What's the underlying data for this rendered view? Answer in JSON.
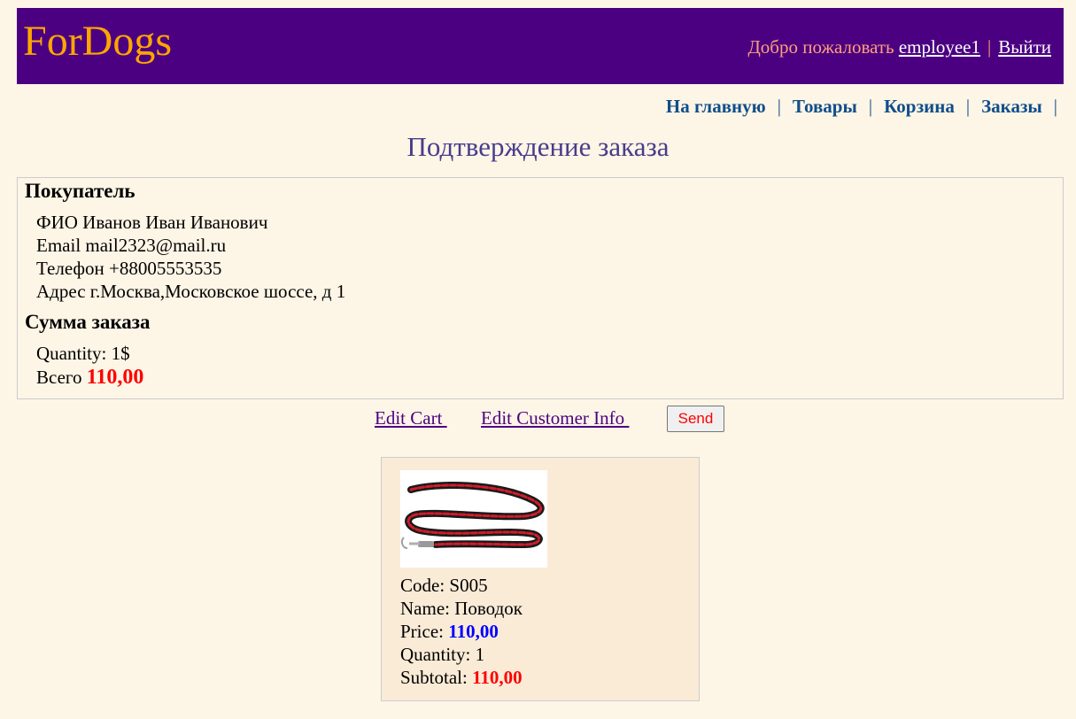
{
  "header": {
    "logo": "ForDogs",
    "welcome_text": "Добро пожаловать",
    "username": "employee1",
    "separator": "|",
    "logout_label": "Выйти"
  },
  "nav": {
    "items": [
      {
        "label": "На главную"
      },
      {
        "label": "Товары"
      },
      {
        "label": "Корзина"
      },
      {
        "label": "Заказы"
      }
    ],
    "separator": "|"
  },
  "page_title": "Подтверждение заказа",
  "customer": {
    "section_title": "Покупатель",
    "name_line": "ФИО Иванов Иван Иванович",
    "email_line": "Email mail2323@mail.ru",
    "phone_line": "Телефон +88005553535",
    "address_line": "Адрес г.Москва,Московское шоссе, д 1"
  },
  "summary": {
    "section_title": "Сумма заказа",
    "quantity_line": "Quantity: 1$",
    "total_label": "Всего",
    "total_value": "110,00"
  },
  "actions": {
    "edit_cart_label": "Edit Cart ",
    "edit_customer_label": "Edit Customer Info ",
    "send_label": "Send"
  },
  "product": {
    "image_icon": "dog-leash-image",
    "code_label": "Code:",
    "code": "S005",
    "name_label": "Name:",
    "name": "Поводок",
    "price_label": "Price:",
    "price": "110,00",
    "quantity_label": "Quantity:",
    "quantity": "1",
    "subtotal_label": "Subtotal:",
    "subtotal": "110,00"
  },
  "colors": {
    "header_bg": "#4b0082",
    "logo": "#ffa500",
    "page_bg": "#fdf5e6",
    "nav_link": "#104e8b",
    "title": "#483d8b",
    "total": "#ff0000",
    "price": "#0000ff"
  }
}
